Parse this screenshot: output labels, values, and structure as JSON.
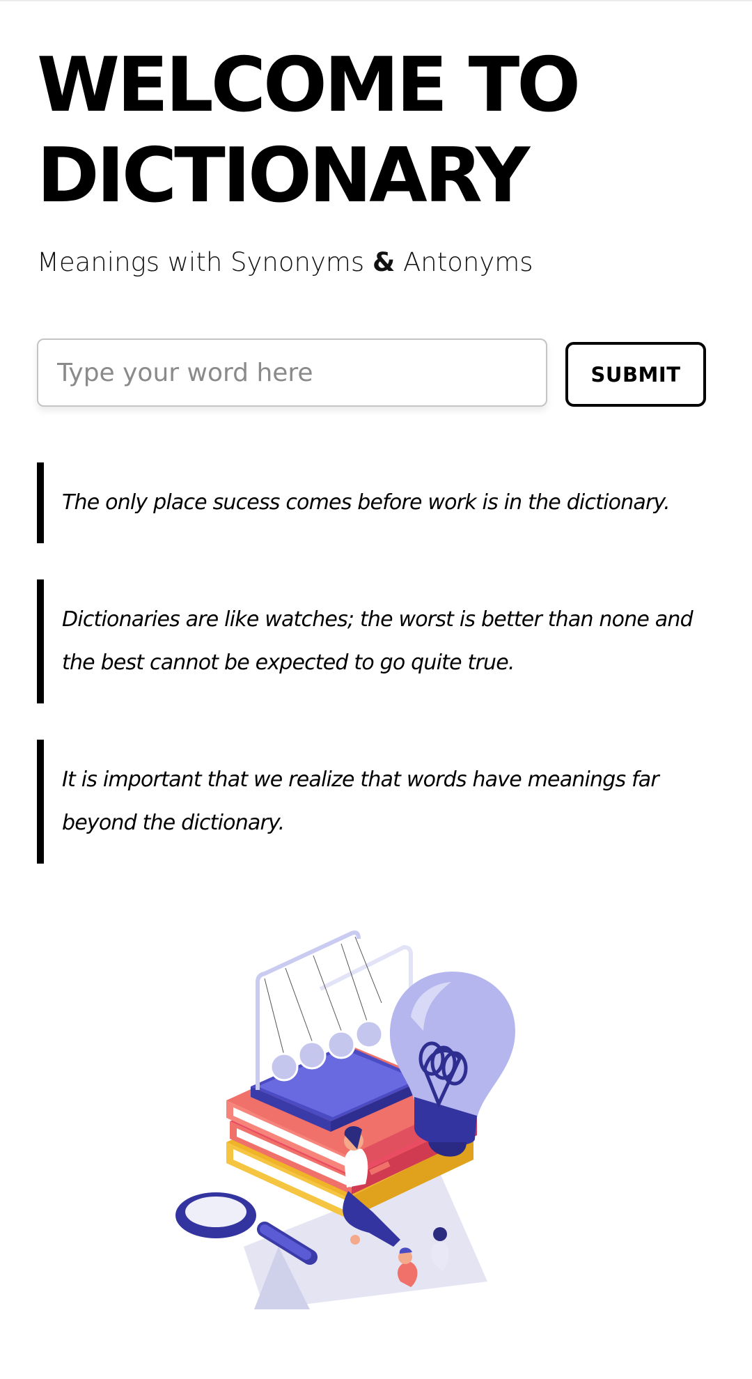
{
  "header": {
    "title_line1": "WELCOME TO",
    "title_line2": "DICTIONARY",
    "subtitle_part1": "Meanings with Synonyms ",
    "subtitle_amp": "&",
    "subtitle_part2": " Antonyms"
  },
  "search": {
    "placeholder": "Type your word here",
    "value": "",
    "submit_label": "SUBMIT"
  },
  "quotes": [
    {
      "text": "The only place sucess comes before work is in the dictionary."
    },
    {
      "text": "Dictionaries are like watches; the worst is better than none and the best cannot be expected to go quite true."
    },
    {
      "text": "It is important that we realize that words have meanings far beyond the dictionary."
    }
  ],
  "colors": {
    "text": "#000000",
    "accent_indigo": "#5b5bd6",
    "book_red": "#f0706a",
    "book_yellow": "#f5c542",
    "bulb_lavender": "#b5b6ee"
  },
  "illustration": {
    "icon": "books-lightbulb-illustration"
  }
}
